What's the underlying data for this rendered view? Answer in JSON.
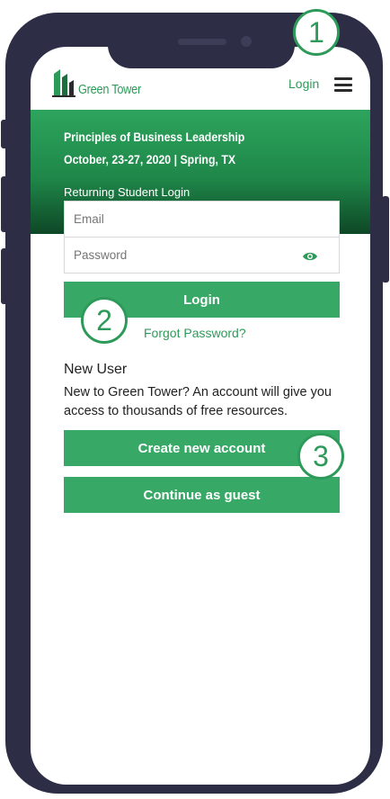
{
  "header": {
    "brand": "Green Tower",
    "nav_login": "Login"
  },
  "event": {
    "title": "Principles of Business Leadership",
    "date_location": "October, 23-27, 2020 | Spring, TX"
  },
  "login_form": {
    "heading": "Returning Student Login",
    "email_placeholder": "Email",
    "password_placeholder": "Password",
    "submit_label": "Login",
    "forgot_label": "Forgot Password?"
  },
  "new_user": {
    "heading": "New User",
    "description": "New to Green Tower? An account will give you access to thousands of free resources.",
    "create_label": "Create new account",
    "guest_label": "Continue as guest"
  },
  "callouts": [
    "1",
    "2",
    "3"
  ],
  "colors": {
    "brand_green": "#38a866",
    "banner_dark": "#0e4726",
    "frame": "#2d2d45"
  }
}
